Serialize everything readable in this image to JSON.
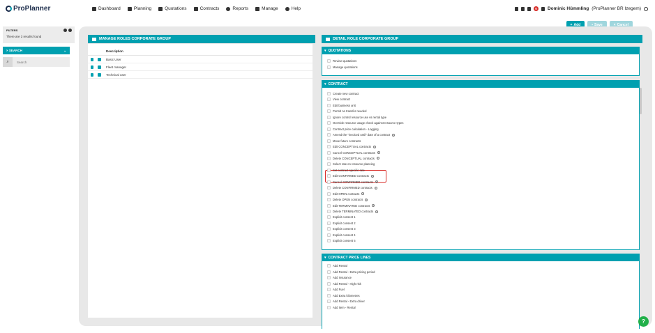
{
  "app": {
    "logo_text": "ProPlanner"
  },
  "nav": [
    {
      "label": "Dashboard",
      "icon": "dashboard-icon"
    },
    {
      "label": "Planning",
      "icon": "planning-icon"
    },
    {
      "label": "Quotations",
      "icon": "quotations-icon"
    },
    {
      "label": "Contracts",
      "icon": "contracts-icon"
    },
    {
      "label": "Reports",
      "icon": "reports-icon"
    },
    {
      "label": "Manage",
      "icon": "manage-icon"
    },
    {
      "label": "Help",
      "icon": "help-icon"
    }
  ],
  "user": {
    "name": "Dominic Hümmling",
    "company": "(ProPlanner BR Izegem)",
    "notifications": "0"
  },
  "toolbar": {
    "add_label": "Add",
    "save_label": "Save",
    "cancel_label": "Cancel"
  },
  "filters": {
    "title": "FILTERS",
    "results": "There are 3 results found"
  },
  "search": {
    "title": "SEARCH",
    "placeholder": "Search"
  },
  "left_panel": {
    "title": "MANAGE ROLES CORPORATE GROUP",
    "column": "Description",
    "rows": [
      "Basic User",
      "Fleet manager",
      "Technical user"
    ]
  },
  "right_panel": {
    "title": "DETAIL ROLE CORPORATE GROUP",
    "sections": [
      {
        "title": "QUOTATIONS",
        "items": [
          "Review quotations",
          "Manage quotations"
        ]
      },
      {
        "title": "CONTRACT",
        "items": [
          "Create new contract",
          "View contract",
          "Edit business unit",
          "Permit no transfer needed",
          "Ignore control resource use vs rental type",
          "Override resource usage check against resource types",
          "Contract price calculation - Logging",
          "Amend the \"invoiced until\" date of a contract",
          "Move future contracts",
          "Edit CONCEPTUAL contracts",
          "Cancel CONCEPTUAL contracts",
          "Delete CONCEPTUAL contracts",
          "Select rate on resource planning",
          "Set contract specific rate",
          "Edit CONFIRMED contracts",
          "Cancel CONFIRMED contracts",
          "Delete CONFIRMED contracts",
          "Edit OPEN contracts",
          "Delete OPEN contracts",
          "Edit TERMINATED contracts",
          "Delete TERMINATED contracts",
          "Explicit consent 1",
          "Explicit consent 2",
          "Explicit consent 3",
          "Explicit consent 4",
          "Explicit consent 5"
        ]
      },
      {
        "title": "CONTRACT PRICE LINES",
        "items": [
          "Add Rental",
          "Add Rental - Extra pricing period",
          "Add Insurance",
          "Add Rental - High risk",
          "Add Fuel",
          "Add Extra kilometres",
          "Add Rental - Extra driver",
          "Add Item - Rental"
        ]
      }
    ]
  },
  "colors": {
    "accent": "#00a0b0",
    "highlight": "#d9302c",
    "help": "#22b04a"
  }
}
